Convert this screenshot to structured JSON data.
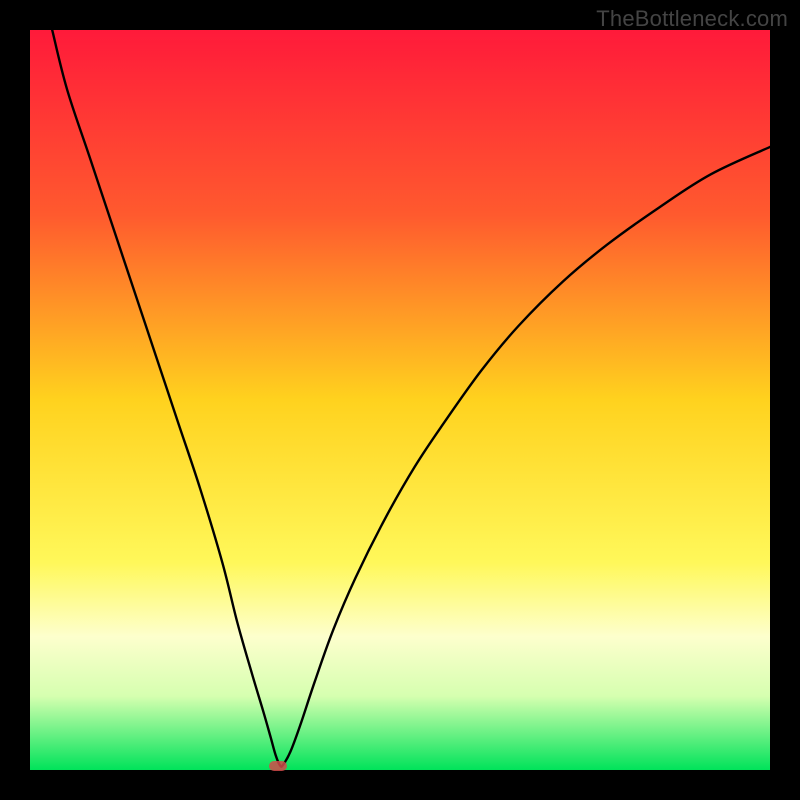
{
  "attribution": "TheBottleneck.com",
  "chart_data": {
    "type": "line",
    "title": "",
    "xlabel": "",
    "ylabel": "",
    "xlim": [
      0,
      100
    ],
    "ylim": [
      0,
      100
    ],
    "grid": false,
    "legend": false,
    "gradient_stops": [
      {
        "offset": 0,
        "color": "#ff1a3a"
      },
      {
        "offset": 25,
        "color": "#ff5a2e"
      },
      {
        "offset": 50,
        "color": "#ffd21e"
      },
      {
        "offset": 72,
        "color": "#fff85a"
      },
      {
        "offset": 82,
        "color": "#fdffcd"
      },
      {
        "offset": 90,
        "color": "#d6ffb0"
      },
      {
        "offset": 100,
        "color": "#00e35a"
      }
    ],
    "series": [
      {
        "name": "bottleneck-curve",
        "color": "#000000",
        "x": [
          3,
          5,
          8,
          11,
          14,
          17,
          20,
          23,
          26,
          28,
          30,
          31.5,
          32.5,
          33.2,
          33.8,
          34.2,
          35.2,
          36.5,
          38.5,
          41,
          44,
          48,
          52,
          56,
          61,
          66,
          72,
          78,
          85,
          92,
          100
        ],
        "y": [
          100,
          92,
          83,
          74,
          65,
          56,
          47,
          38,
          28,
          20,
          13,
          8,
          4.5,
          2,
          0.6,
          0.7,
          2.5,
          6,
          12,
          19,
          26,
          34,
          41,
          47,
          54,
          60,
          66,
          71,
          76,
          80.5,
          84.2
        ]
      }
    ],
    "marker": {
      "x": 33.5,
      "y": 0.6
    }
  }
}
